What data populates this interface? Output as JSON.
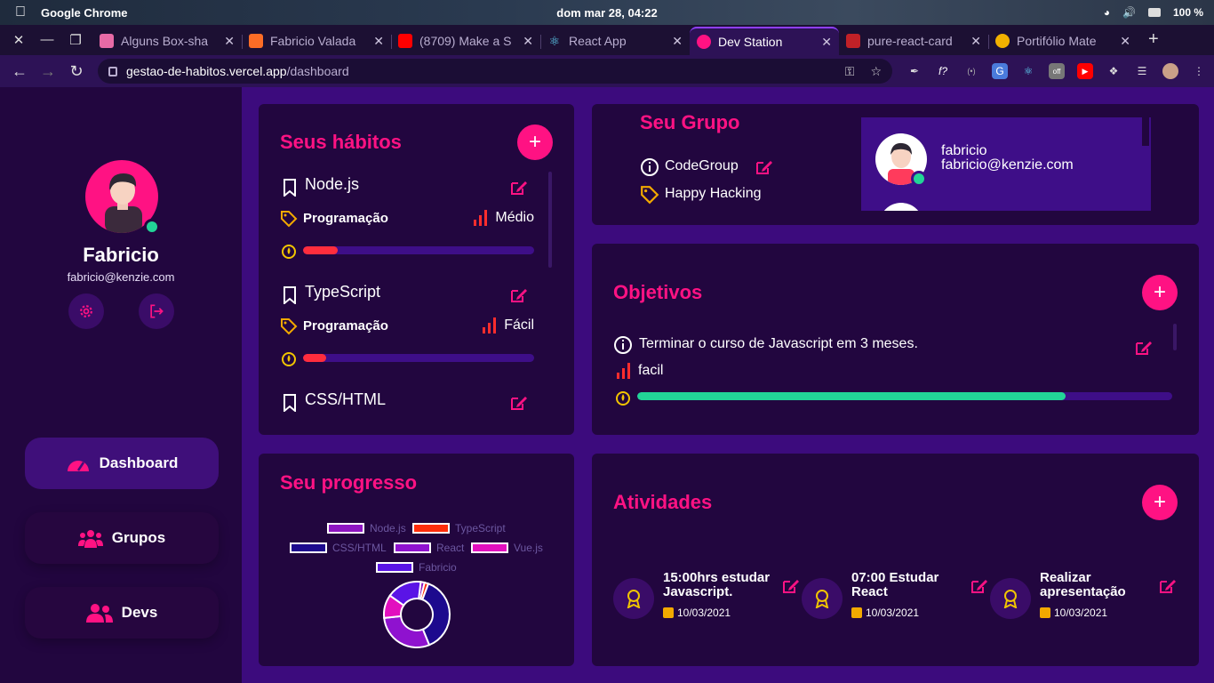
{
  "os": {
    "app_name": "Google Chrome",
    "clock": "dom mar 28, 04:22",
    "battery": "100 %"
  },
  "browser": {
    "tabs": [
      {
        "label": "Alguns Box-sha",
        "color": "#e86aa6"
      },
      {
        "label": "Fabricio Valada",
        "color": "#fc6d26"
      },
      {
        "label": "(8709) Make a S",
        "color": "#ff0000"
      },
      {
        "label": "React App",
        "color": "#61dafb"
      },
      {
        "label": "Dev Station",
        "color": "#ff1283"
      },
      {
        "label": "pure-react-card",
        "color": "#c12127"
      },
      {
        "label": "Portifólio Mate",
        "color": "#f2b100"
      }
    ],
    "url_host": "gestao-de-habitos.vercel.app",
    "url_path": "/dashboard"
  },
  "profile": {
    "name": "Fabricio",
    "email": "fabricio@kenzie.com"
  },
  "nav": {
    "dashboard": "Dashboard",
    "groups": "Grupos",
    "devs": "Devs"
  },
  "habits": {
    "title": "Seus hábitos",
    "items": [
      {
        "name": "Node.js",
        "category": "Programação",
        "difficulty": "Médio",
        "progress": 0.15
      },
      {
        "name": "TypeScript",
        "category": "Programação",
        "difficulty": "Fácil",
        "progress": 0.1
      },
      {
        "name": "CSS/HTML"
      }
    ]
  },
  "group": {
    "title": "Seu Grupo",
    "name": "CodeGroup",
    "tag": "Happy Hacking",
    "member": {
      "name": "fabricio",
      "email": "fabricio@kenzie.com"
    }
  },
  "goals": {
    "title": "Objetivos",
    "items": [
      {
        "text": "Terminar o curso de Javascript em 3 meses.",
        "difficulty": "facil",
        "progress": 0.8
      }
    ]
  },
  "progress": {
    "title": "Seu progresso"
  },
  "chart_data": {
    "type": "pie",
    "categories": [
      "Node.js",
      "TypeScript",
      "CSS/HTML",
      "React",
      "Vue.js",
      "Fabricio"
    ],
    "values": [
      2,
      2,
      40,
      31,
      12,
      18
    ],
    "colors": [
      "#8e15c2",
      "#ff2d0b",
      "#1d0a8e",
      "#8f12cf",
      "#e20fbf",
      "#5a14e6"
    ],
    "title": "",
    "legend": "top"
  },
  "activities": {
    "title": "Atividades",
    "items": [
      {
        "title": "15:00hrs estudar Javascript.",
        "date": "10/03/2021"
      },
      {
        "title": "07:00 Estudar React",
        "date": "10/03/2021"
      },
      {
        "title": "Realizar apresentação",
        "date": "10/03/2021"
      }
    ]
  },
  "theme": {
    "accent": "#ff1283",
    "success": "#22d497",
    "card": "#22063f",
    "background": "#3c0b7d"
  }
}
